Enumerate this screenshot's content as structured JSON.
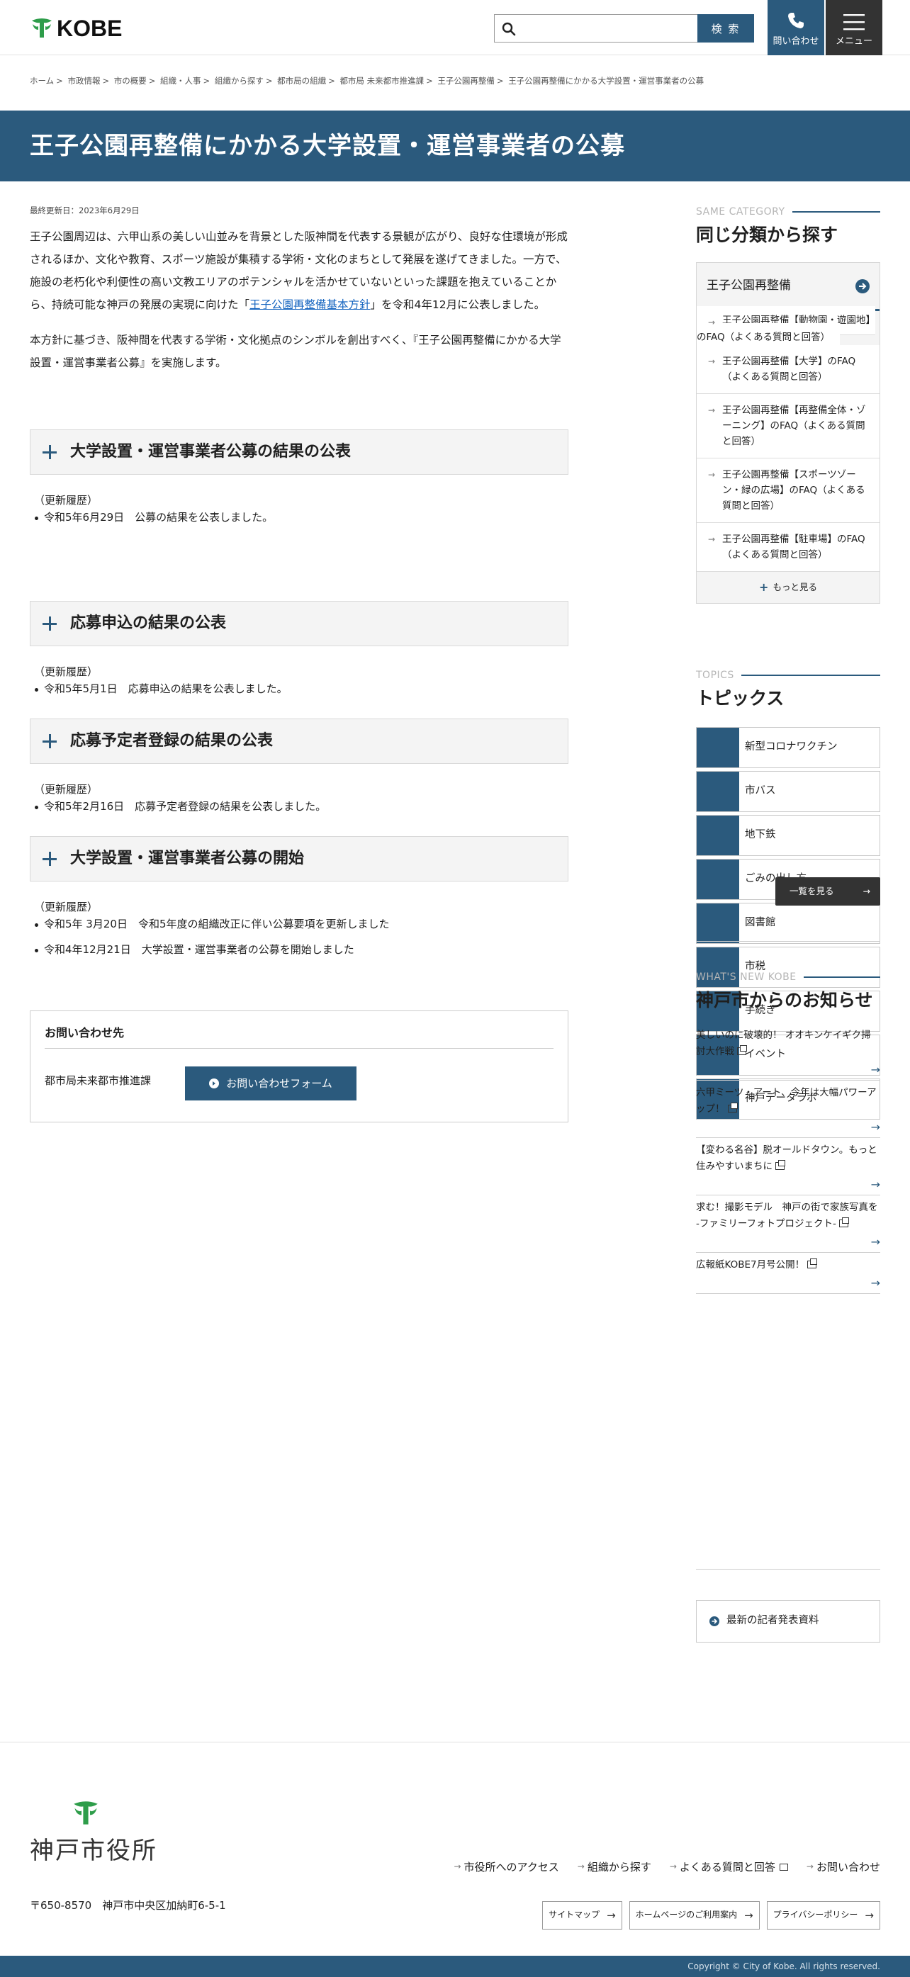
{
  "header": {
    "logo_text": "KOBE",
    "search_placeholder": "",
    "search_button": "検 索",
    "contact_label": "問い合わせ",
    "menu_label": "メニュー",
    "accent_color": "#2b5a7d"
  },
  "breadcrumb": [
    "ホーム",
    "市政情報",
    "市の概要",
    "組織・人事",
    "組織から探す",
    "都市局の組織",
    "都市局 未来都市推進課",
    "王子公園再整備",
    "王子公園再整備にかかる大学設置・運営事業者の公募"
  ],
  "page": {
    "title": "王子公園再整備にかかる大学設置・運営事業者の公募",
    "updated": "最終更新日：2023年6月29日",
    "intro_p1_a": "王子公園周辺は、六甲山系の美しい山並みを背景とした阪神間を代表する景観が広がり、良好な住環境が形成されるほか、文化や教育、スポーツ施設が集積する学術・文化のまちとして発展を遂げてきました。一方で、施設の老朽化や利便性の高い文教エリアのポテンシャルを活かせていないといった課題を抱えていることから、持続可能な神戸の発展の実現に向けた「",
    "intro_p1_link": "王子公園再整備基本方針",
    "intro_p1_b": "」を令和4年12月に公表しました。",
    "intro_p2": "本方針に基づき、阪神間を代表する学術・文化拠点のシンボルを創出すべく、『王子公園再整備にかかる大学設置・運営事業者公募』を実施します。"
  },
  "sections": [
    {
      "title": "大学設置・運営事業者公募の結果の公表",
      "history_label": "（更新履歴）",
      "items": [
        "令和5年6月29日　公募の結果を公表しました。"
      ]
    },
    {
      "title": "応募申込の結果の公表",
      "history_label": "（更新履歴）",
      "items": [
        "令和5年5月1日　応募申込の結果を公表しました。"
      ]
    },
    {
      "title": "応募予定者登録の結果の公表",
      "history_label": "（更新履歴）",
      "items": [
        "令和5年2月16日　応募予定者登録の結果を公表しました。"
      ]
    },
    {
      "title": "大学設置・運営事業者公募の開始",
      "history_label": "（更新履歴）",
      "items": [
        "令和5年 3月20日　令和5年度の組織改正に伴い公募要項を更新しました",
        "令和4年12月21日　大学設置・運営事業者の公募を開始しました"
      ]
    }
  ],
  "contact": {
    "heading": "お問い合わせ先",
    "department": "都市局未来都市推進課",
    "form_button": "お問い合わせフォーム"
  },
  "sidebar": {
    "same_category": {
      "eyebrow": "SAME CATEGORY",
      "heading": "同じ分類から探す",
      "current": "王子公園再整備",
      "items": [
        "王子公園再整備【動物園・遊園地】のFAQ（よくある質問と回答）",
        "王子公園再整備【大学】のFAQ（よくある質問と回答）",
        "王子公園再整備【再整備全体・ゾーニング】のFAQ（よくある質問と回答）",
        "王子公園再整備【スポーツゾーン・緑の広場】のFAQ（よくある質問と回答）",
        "王子公園再整備【駐車場】のFAQ（よくある質問と回答）"
      ],
      "more": "もっと見る"
    },
    "topics": {
      "eyebrow": "TOPICS",
      "heading": "トピックス",
      "items": [
        "新型コロナワクチン",
        "市バス",
        "地下鉄",
        "ごみの出し方",
        "図書館",
        "市税",
        "手続き",
        "イベント",
        "神戸データラボ"
      ],
      "see_all": "一覧を見る"
    },
    "news": {
      "eyebrow": "WHAT'S NEW KOBE",
      "heading": "神戸市からのお知らせ",
      "items": [
        "美しいのに破壊的！ オオキンケイギク掃討大作戦",
        "六甲ミーツ・アート、今年は大幅パワーアップ！",
        "【変わる名谷】脱オールドタウン。もっと住みやすいまちに",
        "求む！撮影モデル　神戸の街で家族写真を -ファミリーフォトプロジェクト-",
        "広報紙KOBE7月号公開！"
      ]
    },
    "press": "最新の記者発表資料"
  },
  "footer": {
    "logo_text": "神戸市役所",
    "links": [
      "市役所へのアクセス",
      "組織から探す",
      "よくある質問と回答",
      "お問い合わせ"
    ],
    "address": "〒650-8570　神戸市中央区加納町6-5-1",
    "small_links": [
      "サイトマップ",
      "ホームページのご利用案内",
      "プライバシーポリシー"
    ],
    "copyright": "Copyright © City of Kobe. All rights reserved."
  }
}
